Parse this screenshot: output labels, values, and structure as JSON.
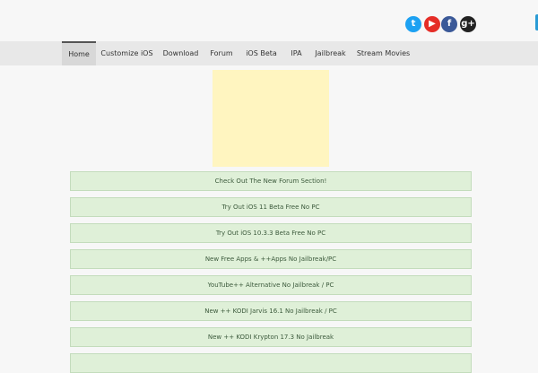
{
  "header": {
    "social": [
      {
        "name": "twitter-icon",
        "glyph": "t",
        "color": "#1da1f2"
      },
      {
        "name": "youtube-icon",
        "glyph": "▶",
        "color": "#e52d27"
      },
      {
        "name": "facebook-icon",
        "glyph": "f",
        "color": "#3b5998"
      },
      {
        "name": "google-plus-icon",
        "glyph": "g+",
        "color": "#222222"
      }
    ],
    "edge_tab_color": "#2a9bd5"
  },
  "nav": {
    "items": [
      {
        "label": "Home",
        "active": true
      },
      {
        "label": "Customize iOS"
      },
      {
        "label": "Download"
      },
      {
        "label": "Forum"
      },
      {
        "label": "iOS Beta"
      },
      {
        "label": "IPA"
      },
      {
        "label": "Jailbreak"
      },
      {
        "label": "Stream Movies"
      }
    ]
  },
  "ad": {
    "color": "#fff5c0"
  },
  "links": [
    {
      "label": "Check Out The New Forum Section!"
    },
    {
      "label": "Try Out iOS 11 Beta Free No PC"
    },
    {
      "label": "Try Out iOS 10.3.3 Beta Free No PC"
    },
    {
      "label": "New Free Apps & ++Apps No Jailbreak/PC"
    },
    {
      "label": "YouTube++ Alternative No Jailbreak / PC"
    },
    {
      "label": "New ++ KODI Jarvis 16.1 No Jailbreak / PC"
    },
    {
      "label": "New ++ KODI Krypton 17.3 No Jailbreak"
    },
    {
      "label": ""
    }
  ]
}
